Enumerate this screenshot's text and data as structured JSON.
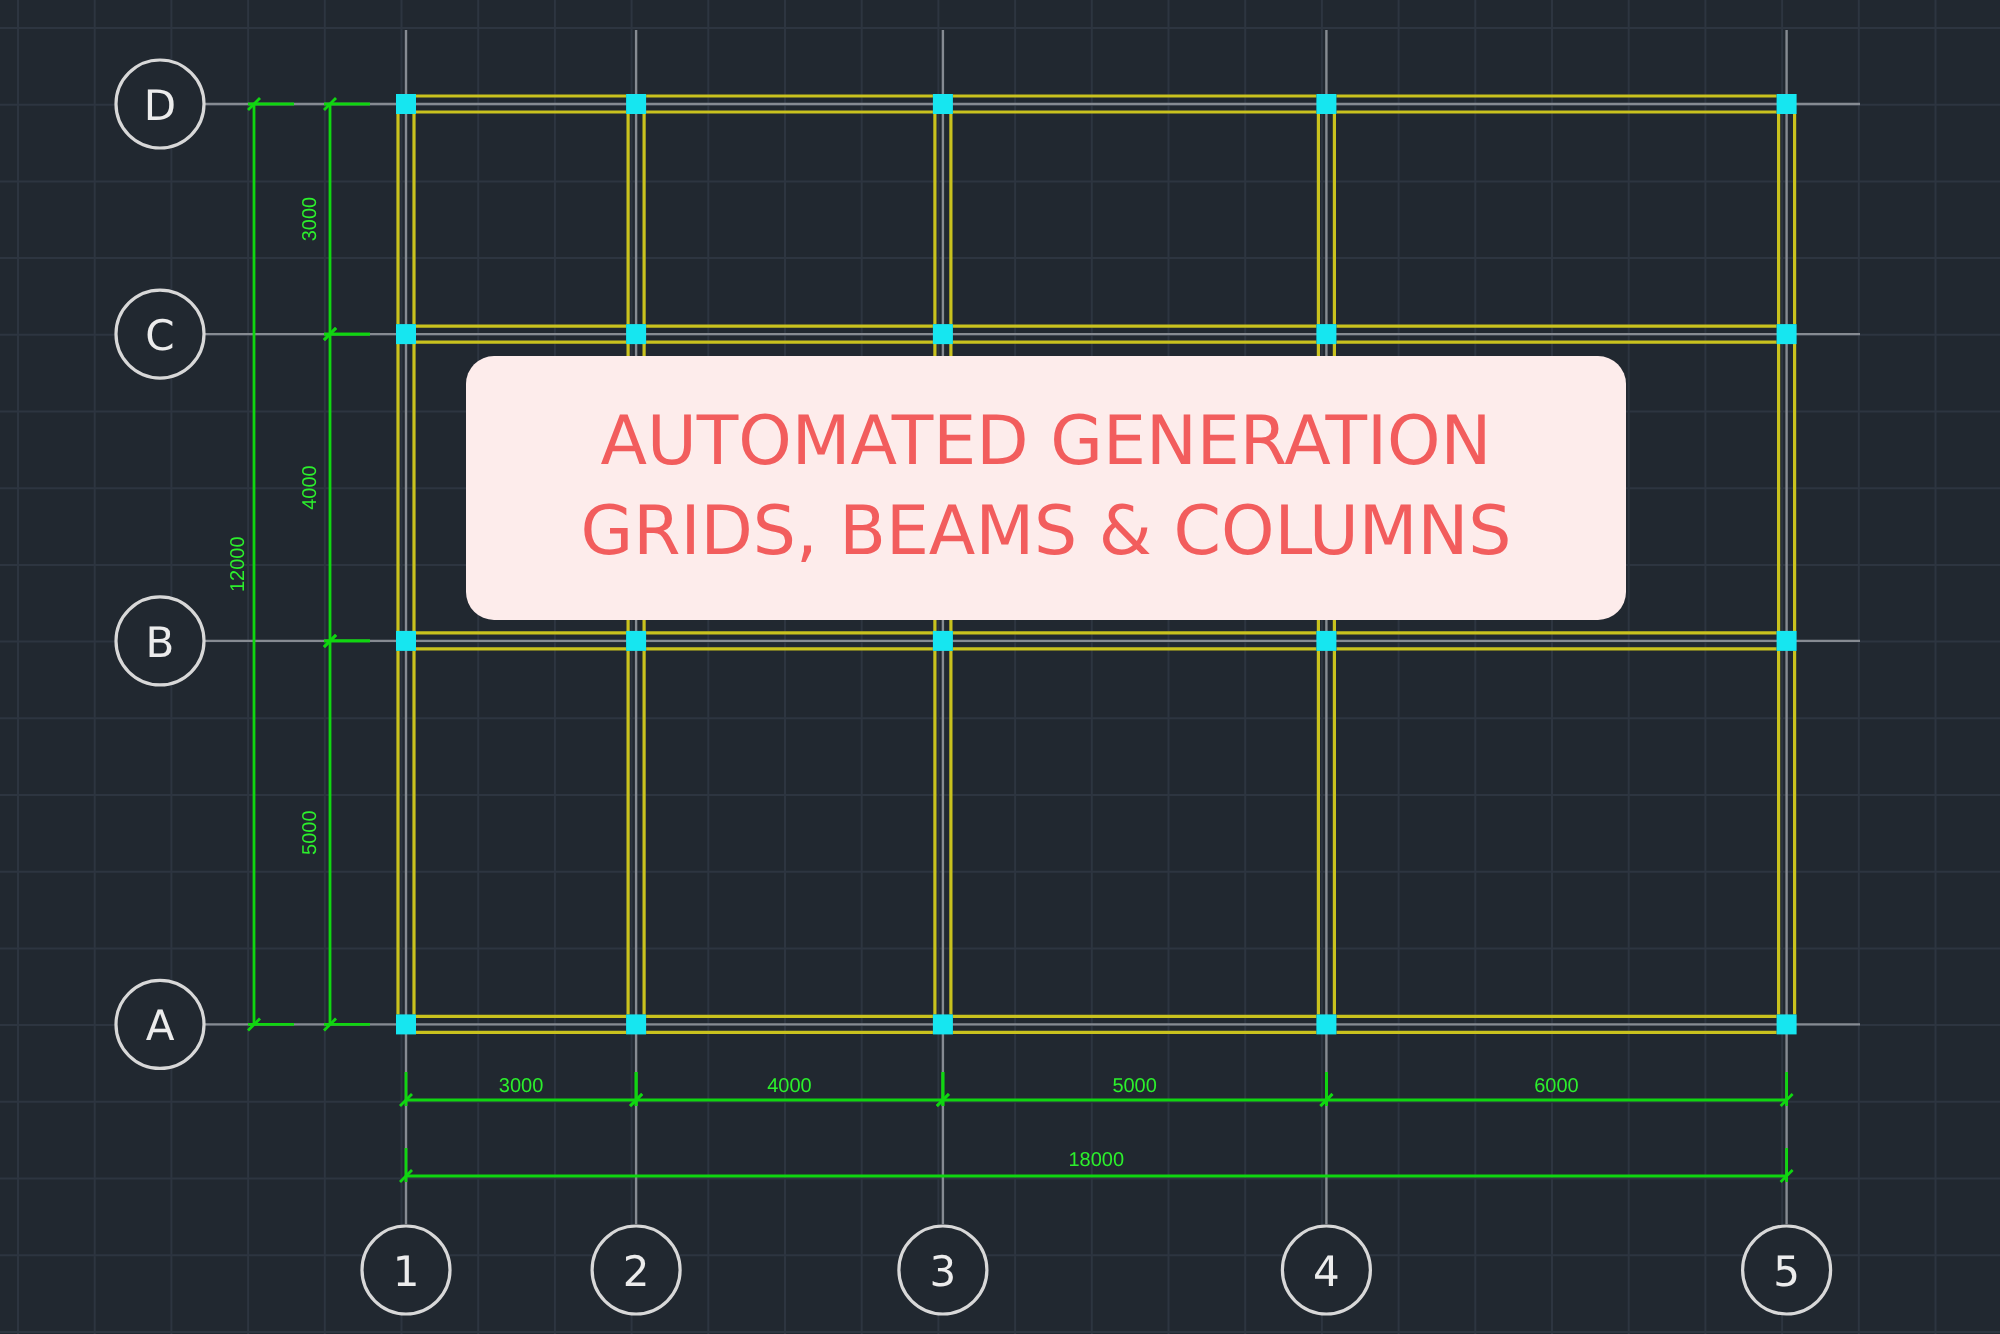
{
  "drawing": {
    "vertical_axes": [
      {
        "label": "1"
      },
      {
        "label": "2"
      },
      {
        "label": "3"
      },
      {
        "label": "4"
      },
      {
        "label": "5"
      }
    ],
    "horizontal_axes": [
      {
        "label": "D"
      },
      {
        "label": "C"
      },
      {
        "label": "B"
      },
      {
        "label": "A"
      }
    ],
    "horizontal_dimensions": [
      "3000",
      "4000",
      "5000",
      "6000"
    ],
    "horizontal_total": "18000",
    "vertical_dimensions": [
      "3000",
      "4000",
      "5000"
    ],
    "vertical_total": "12000"
  },
  "title": {
    "lines": [
      "AUTOMATED GENERATION",
      "GRIDS, BEAMS & COLUMNS"
    ]
  }
}
